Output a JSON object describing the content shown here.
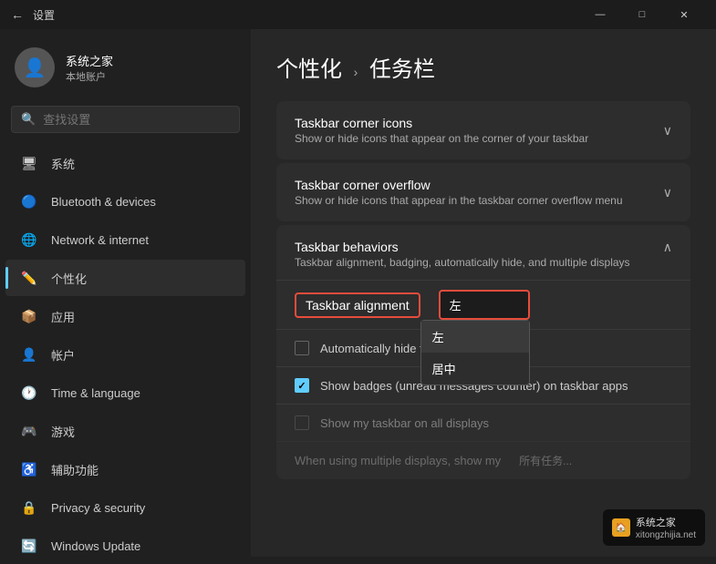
{
  "window": {
    "title": "设置",
    "controls": {
      "minimize": "—",
      "maximize": "□",
      "close": "✕"
    }
  },
  "user": {
    "name": "系统之家",
    "subtitle": "本地账户",
    "avatar_icon": "👤"
  },
  "search": {
    "placeholder": "查找设置",
    "icon": "🔍"
  },
  "nav": {
    "items": [
      {
        "id": "system",
        "icon": "🖥",
        "label": "系统"
      },
      {
        "id": "bluetooth",
        "icon": "🔵",
        "label": "Bluetooth & devices"
      },
      {
        "id": "network",
        "icon": "🌐",
        "label": "Network & internet"
      },
      {
        "id": "personalization",
        "icon": "✏️",
        "label": "个性化",
        "active": true
      },
      {
        "id": "apps",
        "icon": "📦",
        "label": "应用"
      },
      {
        "id": "accounts",
        "icon": "👤",
        "label": "帐户"
      },
      {
        "id": "time",
        "icon": "🕐",
        "label": "Time & language"
      },
      {
        "id": "gaming",
        "icon": "🎮",
        "label": "游戏"
      },
      {
        "id": "accessibility",
        "icon": "♿",
        "label": "辅助功能"
      },
      {
        "id": "privacy",
        "icon": "🔒",
        "label": "Privacy & security"
      },
      {
        "id": "windows-update",
        "icon": "🔄",
        "label": "Windows Update"
      }
    ]
  },
  "page": {
    "breadcrumb1": "个性化",
    "breadcrumb_sep": "›",
    "breadcrumb2": "任务栏",
    "title": "个性化 › 任务栏"
  },
  "settings": {
    "corner_icons": {
      "title": "Taskbar corner icons",
      "desc": "Show or hide icons that appear on the corner of your taskbar"
    },
    "corner_overflow": {
      "title": "Taskbar corner overflow",
      "desc": "Show or hide icons that appear in the taskbar corner overflow menu"
    },
    "behaviors": {
      "title": "Taskbar behaviors",
      "desc": "Taskbar alignment, badging, automatically hide, and multiple displays"
    },
    "alignment": {
      "label": "Taskbar alignment",
      "selected": "左",
      "options": [
        "左",
        "居中"
      ]
    },
    "auto_hide": {
      "label": "Automatically hide the taskbar",
      "checked": false
    },
    "show_badges": {
      "label": "Show badges (unread messages counter) on taskbar apps",
      "checked": true
    },
    "show_all_displays": {
      "label": "Show my taskbar on all displays",
      "checked": false,
      "disabled": true
    },
    "multiple_displays": {
      "label": "When using multiple displays, show my",
      "value": "所有任务..."
    }
  },
  "watermark": {
    "logo_text": "🏠",
    "text": "系统之家",
    "url": "xitongzhijia.net"
  }
}
